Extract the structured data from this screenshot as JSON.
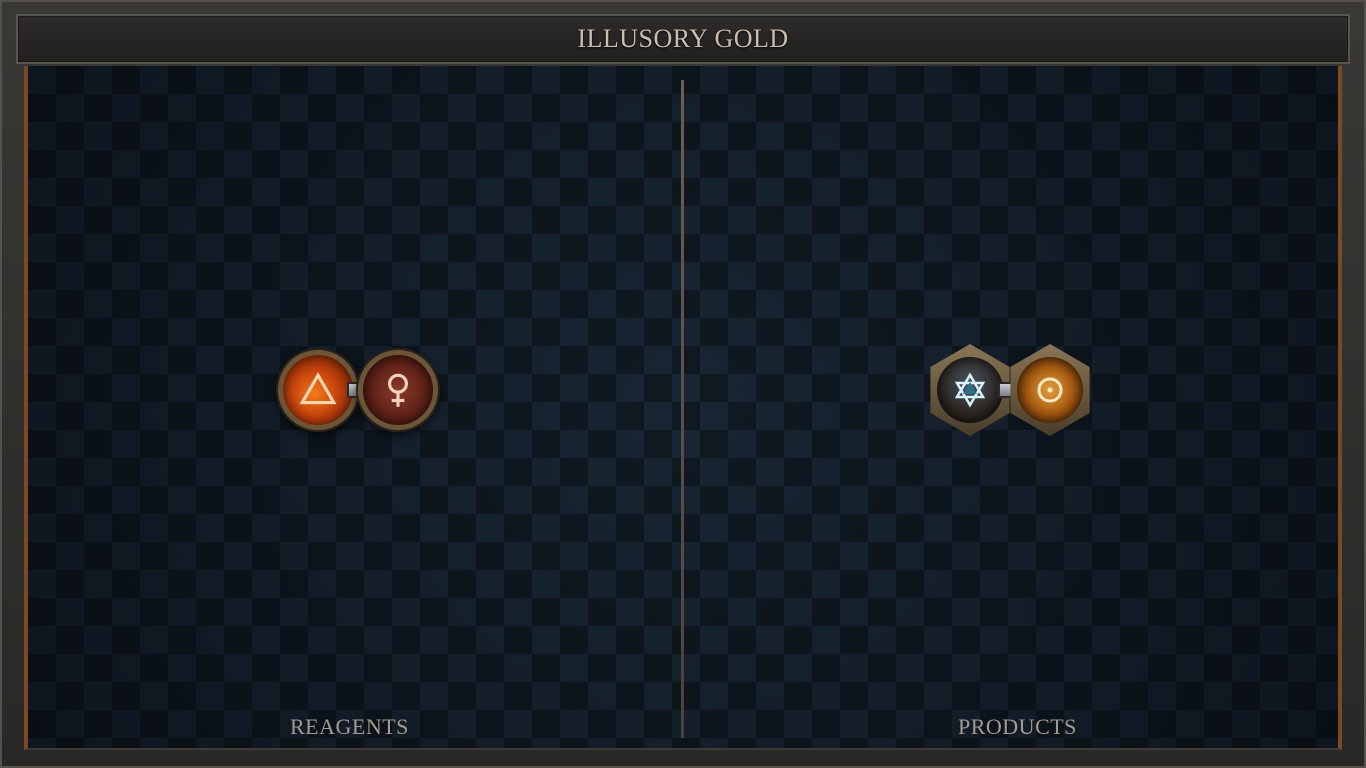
{
  "header": {
    "title": "ILLUSORY GOLD"
  },
  "reagents": {
    "label": "REAGENTS",
    "items": [
      {
        "icon": "fire-triangle-icon",
        "color": "#e8631a"
      },
      {
        "icon": "venus-icon",
        "color": "#6b2a1d"
      }
    ]
  },
  "products": {
    "label": "PRODUCTS",
    "items": [
      {
        "icon": "hexagram-icon",
        "color": "#2e6f8a"
      },
      {
        "icon": "sun-circle-icon",
        "color": "#c77a1e"
      }
    ]
  },
  "colors": {
    "accent": "#7a4a24",
    "title_text": "#c9bfae",
    "label_text": "#a39b8e",
    "background": "#101a24"
  }
}
